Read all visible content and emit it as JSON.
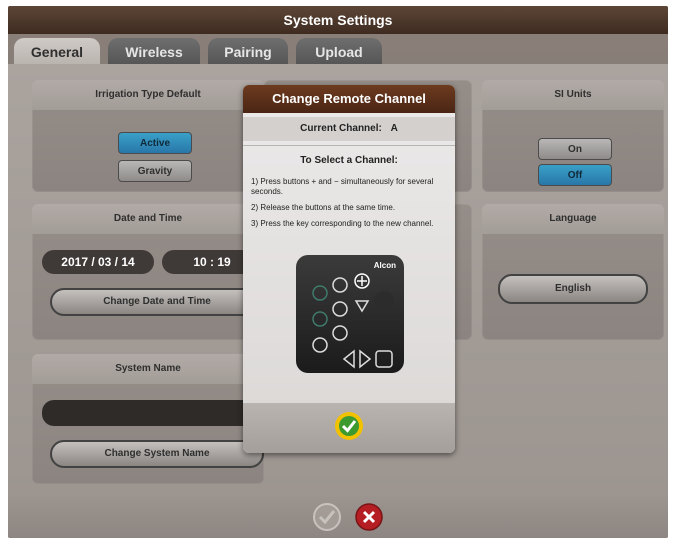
{
  "window": {
    "title": "System Settings"
  },
  "tabs": [
    {
      "label": "General",
      "active": true
    },
    {
      "label": "Wireless",
      "active": false
    },
    {
      "label": "Pairing",
      "active": false
    },
    {
      "label": "Upload",
      "active": false
    }
  ],
  "panels": {
    "irrigation": {
      "title": "Irrigation Type Default",
      "options": [
        {
          "label": "Active",
          "selected": true
        },
        {
          "label": "Gravity",
          "selected": false
        }
      ]
    },
    "date_time": {
      "title": "Date and Time",
      "date": "2017 / 03 / 14",
      "time": "10 : 19",
      "button": "Change Date and Time"
    },
    "system_name": {
      "title": "System Name",
      "value": "",
      "button": "Change System Name"
    },
    "si_units": {
      "title": "SI Units",
      "options": [
        {
          "label": "On",
          "selected": false
        },
        {
          "label": "Off",
          "selected": true
        }
      ]
    },
    "language": {
      "title": "Language",
      "value": "English"
    }
  },
  "dialog": {
    "title": "Change Remote Channel",
    "current_channel_label": "Current Channel:",
    "current_channel_value": "A",
    "instructions_heading": "To Select a Channel:",
    "steps": [
      "1) Press buttons + and − simultaneously for several seconds.",
      "2) Release the buttons at the same time.",
      "3) Press the key corresponding to the new channel."
    ],
    "remote_brand": "Alcon",
    "confirm_icon": "check-circle-icon"
  },
  "footer": {
    "accept_icon": "check-icon",
    "cancel_icon": "x-circle-icon"
  },
  "colors": {
    "accent_active": "#2a86b8",
    "title_bar": "#4a3527",
    "dialog_title": "#5a2e19",
    "confirm_ring": "#f2c200",
    "confirm_green": "#3c9a2e",
    "cancel_red": "#b51e22"
  }
}
